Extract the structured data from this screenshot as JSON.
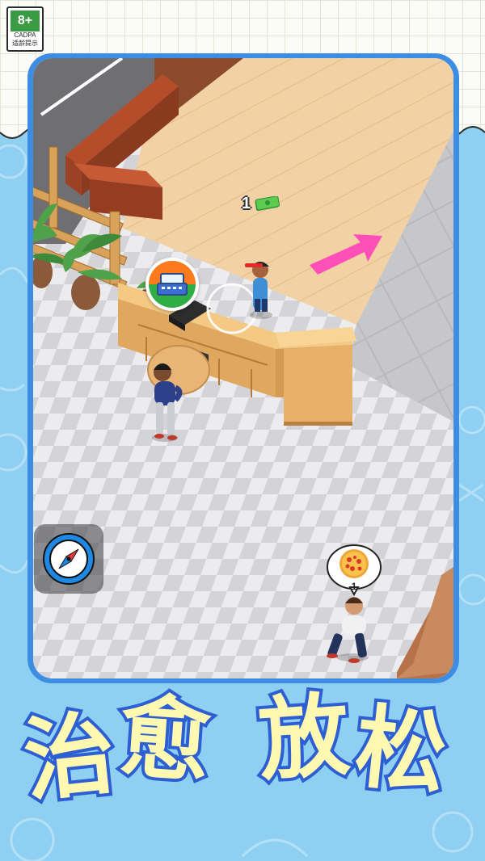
{
  "age_rating": {
    "value": "8+",
    "org": "CADPA",
    "caption": "适龄提示",
    "color": "#3b9b45"
  },
  "hud": {
    "cash_amount": "1",
    "cash_icon": "money-bill-icon",
    "register_icon": "cash-register-icon",
    "compass_icon": "compass-icon",
    "arrow_icon": "direction-arrow-icon"
  },
  "order": {
    "item_icon": "pizza-icon",
    "quantity": "1"
  },
  "promo": {
    "word1_char1": "治",
    "word1_char2": "愈",
    "word2_char1": "放",
    "word2_char2": "松"
  },
  "colors": {
    "frame": "#3d8de3",
    "floor_wood": "#f2d2a4",
    "arrow": "#ff4fb8",
    "title_fill": "#fff8b0",
    "title_stroke": "#2d5fd3",
    "register_green": "#2fae45",
    "register_orange": "#ff7a1c"
  }
}
